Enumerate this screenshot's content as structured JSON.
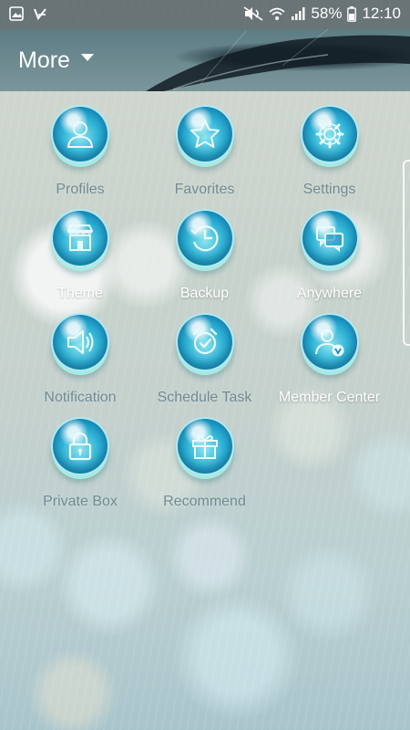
{
  "status_bar": {
    "left_icons": [
      "gallery-notification-icon",
      "check-notification-icon"
    ],
    "right_icons": [
      "mute-icon",
      "wifi-icon",
      "signal-icon",
      "battery-icon"
    ],
    "battery": "58%",
    "time": "12:10"
  },
  "header": {
    "title": "More",
    "dropdown_icon": "caret-down-icon"
  },
  "items": [
    {
      "label": "Profiles",
      "icon": "profile-icon"
    },
    {
      "label": "Favorites",
      "icon": "star-icon"
    },
    {
      "label": "Settings",
      "icon": "gear-icon"
    },
    {
      "label": "Theme",
      "icon": "store-icon"
    },
    {
      "label": "Backup",
      "icon": "history-icon"
    },
    {
      "label": "Anywhere",
      "icon": "chat-windows-icon"
    },
    {
      "label": "Notification",
      "icon": "speaker-icon"
    },
    {
      "label": "Schedule Task",
      "icon": "alarm-clock-icon"
    },
    {
      "label": "Member Center",
      "icon": "member-icon"
    },
    {
      "label": "Private Box",
      "icon": "lock-icon"
    },
    {
      "label": "Recommend",
      "icon": "gift-icon"
    }
  ],
  "colors": {
    "label_text": "#6f8a91",
    "orb_blue": "#2fb3d6",
    "header_bg": "#5d7c84"
  }
}
